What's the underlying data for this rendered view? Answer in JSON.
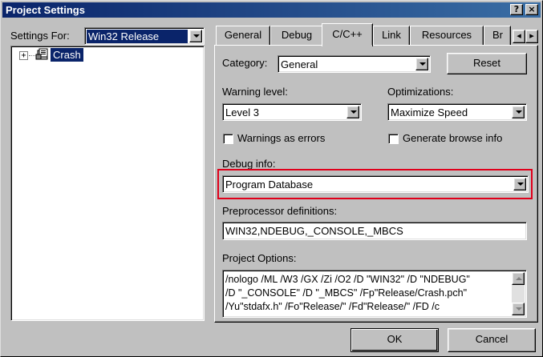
{
  "window": {
    "title": "Project Settings",
    "help_glyph": "?",
    "close_glyph": "×"
  },
  "left_panel": {
    "settings_for_label": "Settings For:",
    "settings_for_value": "Win32 Release",
    "tree": {
      "expander": "+",
      "items": [
        {
          "label": "Crash",
          "selected": true
        }
      ]
    }
  },
  "tabs": [
    {
      "label": "General"
    },
    {
      "label": "Debug"
    },
    {
      "label": "C/C++",
      "active": true
    },
    {
      "label": "Link"
    },
    {
      "label": "Resources"
    },
    {
      "label": "Br"
    }
  ],
  "tab_scroll": {
    "left": "◂",
    "right": "▸"
  },
  "cpp_tab": {
    "category_label": "Category:",
    "category_value": "General",
    "reset_label": "Reset",
    "warning_level_label": "Warning level:",
    "warning_level_value": "Level 3",
    "optimizations_label": "Optimizations:",
    "optimizations_value": "Maximize Speed",
    "warnings_as_errors_label": "Warnings as errors",
    "warnings_as_errors_checked": false,
    "browse_info_label": "Generate browse info",
    "browse_info_checked": false,
    "debug_info_label": "Debug info:",
    "debug_info_value": "Program Database",
    "highlight_color": "#e0001b",
    "preprocessor_label": "Preprocessor definitions:",
    "preprocessor_value": "WIN32,NDEBUG,_CONSOLE,_MBCS",
    "project_options_label": "Project Options:",
    "project_options_lines": [
      "/nologo /ML /W3 /GX /Zi /O2 /D \"WIN32\" /D \"NDEBUG\"",
      "/D \"_CONSOLE\" /D \"_MBCS\" /Fp\"Release/Crash.pch\"",
      "/Yu\"stdafx.h\" /Fo\"Release/\" /Fd\"Release/\" /FD /c"
    ]
  },
  "footer": {
    "ok_label": "OK",
    "cancel_label": "Cancel"
  },
  "colors": {
    "titlebar_start": "#0a246a",
    "titlebar_end": "#3a6ea5",
    "selection": "#0a246a",
    "face": "#c0c0c0"
  }
}
